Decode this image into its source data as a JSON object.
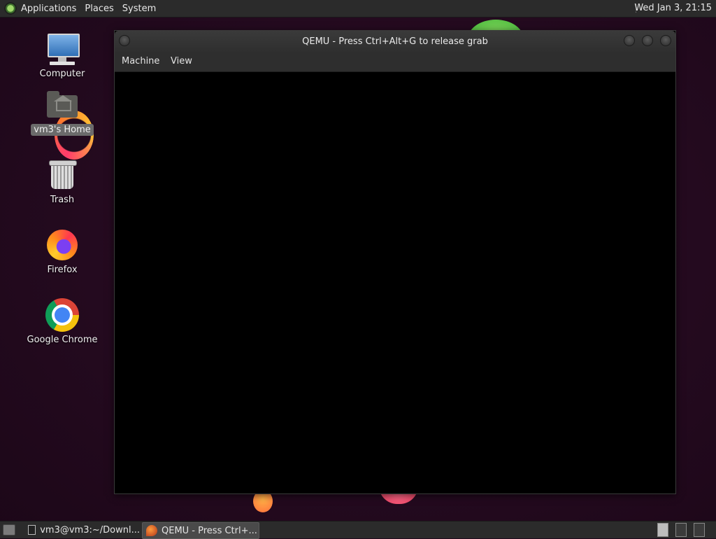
{
  "top_panel": {
    "menus": [
      "Applications",
      "Places",
      "System"
    ],
    "clock": "Wed Jan  3, 21:15"
  },
  "desktop": {
    "icons": [
      {
        "label": "Computer",
        "icon": "computer-icon"
      },
      {
        "label": "vm3's Home",
        "icon": "home-folder-icon",
        "selected": true
      },
      {
        "label": "Trash",
        "icon": "trash-icon"
      },
      {
        "label": "Firefox",
        "icon": "firefox-icon"
      },
      {
        "label": "Google Chrome",
        "icon": "chrome-icon"
      }
    ]
  },
  "window": {
    "title": "QEMU - Press Ctrl+Alt+G to release grab",
    "menus": [
      "Machine",
      "View"
    ]
  },
  "taskbar": {
    "tasks": [
      {
        "label": "vm3@vm3:~/Downl...",
        "icon": "terminal-icon",
        "active": false
      },
      {
        "label": "QEMU - Press Ctrl+...",
        "icon": "qemu-icon",
        "active": true
      }
    ],
    "workspaces": 3
  }
}
